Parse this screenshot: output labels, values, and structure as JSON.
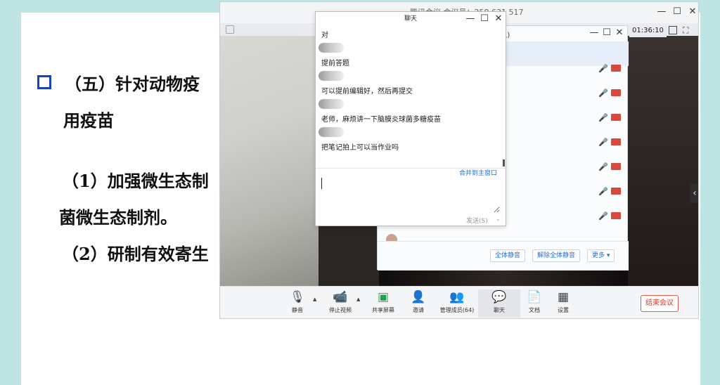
{
  "slide": {
    "line1_prefix": "（五）针对动物疫",
    "line2": "用疫苗",
    "line3": "（1）加强微生态制",
    "line4": "菌微生态制剂。",
    "line5": "（2）研制有效寄生"
  },
  "meeting": {
    "title": "腾讯会议 会议号：259 631 517",
    "timer": "01:36:10",
    "controls": {
      "minimize": "—",
      "maximize": "☐",
      "close": "✕"
    }
  },
  "toolbar": {
    "items": [
      {
        "label": "静音",
        "icon": "microphone-icon"
      },
      {
        "label": "停止视频",
        "icon": "camera-icon"
      },
      {
        "label": "共享屏幕",
        "icon": "share-screen-icon"
      },
      {
        "label": "邀请",
        "icon": "invite-icon"
      },
      {
        "label": "管理成员(64)",
        "icon": "members-icon"
      },
      {
        "label": "聊天",
        "icon": "chat-icon"
      },
      {
        "label": "文档",
        "icon": "document-icon"
      },
      {
        "label": "设置",
        "icon": "settings-icon"
      }
    ],
    "end_label": "结束会议"
  },
  "participants": {
    "title": "4人)",
    "mute_all": "全体静音",
    "unmute_all": "解除全体静音",
    "more": "更多 ▾"
  },
  "chat": {
    "title": "聊天",
    "messages": [
      {
        "text": "对"
      },
      {
        "text": "提前答题"
      },
      {
        "text": "可以提前编辑好，然后再提交"
      },
      {
        "text": "老师，麻烦讲一下脑膜炎球菌多糖疫苗"
      },
      {
        "text": "把笔记拍上可以当作业吗"
      }
    ],
    "merge_label": "合并到主窗口",
    "send_label": "发送(S)",
    "input_value": ""
  },
  "colors": {
    "accent": "#2b6ed6",
    "danger": "#e0392b",
    "bullet": "#1a3fc9"
  }
}
